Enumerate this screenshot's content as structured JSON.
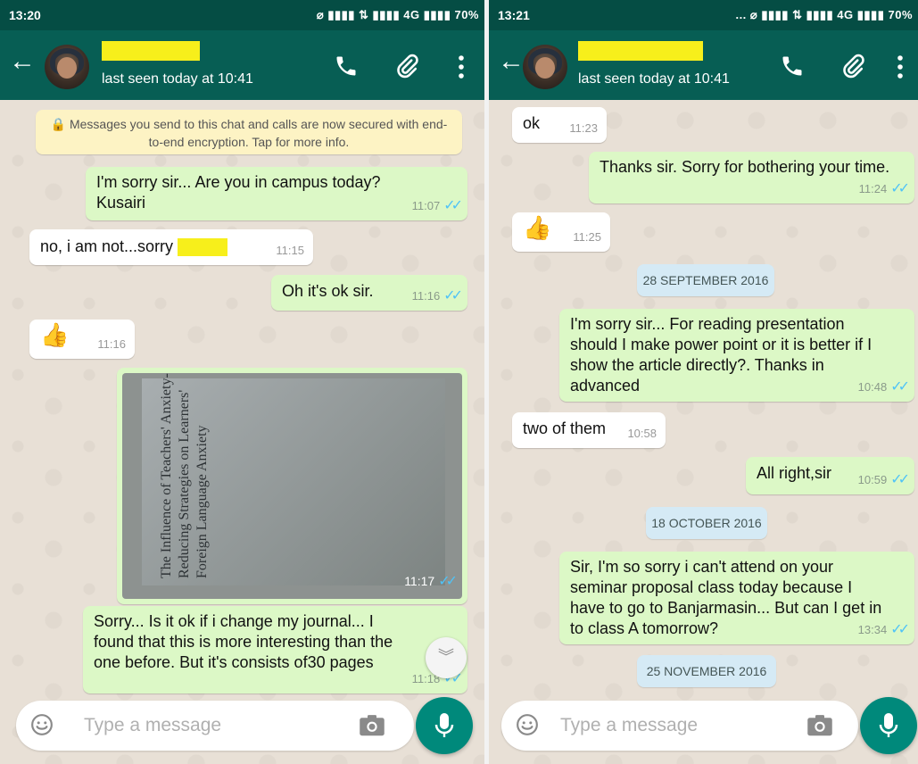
{
  "left": {
    "status": {
      "time": "13:20",
      "indicators": "⌀ ▮▮▮▮ ⇅ ▮▮▮▮ 4G  ▮▮▮▮ 70%"
    },
    "header": {
      "last_seen": "last seen today at 10:41"
    },
    "encryption_notice": "Messages you send to this chat and calls are now secured with end-to-end encryption. Tap for more info.",
    "messages": [
      {
        "text1": "I'm sorry sir... Are you in campus today?",
        "text2": "Kusairi",
        "time": "11:07"
      },
      {
        "text": "no, i am not...sorry",
        "time": "11:15"
      },
      {
        "text": "Oh it's ok sir.",
        "time": "11:16"
      },
      {
        "time": "11:16"
      },
      {
        "time": "11:17",
        "image_text": "The Influence of Teachers' Anxiety-Reducing Strategies on Learners' Foreign Language Anxiety"
      },
      {
        "line1": "Sorry... Is it ok if i change my journal... I",
        "line2": "found that this is more interesting than the",
        "line3": "one before. But it's consists of30 pages",
        "time": "11:18"
      }
    ],
    "input_placeholder": "Type a message"
  },
  "right": {
    "status": {
      "time": "13:21",
      "indicators": "... ⌀ ▮▮▮▮ ⇅ ▮▮▮▮ 4G  ▮▮▮▮ 70%"
    },
    "header": {
      "last_seen": "last seen today at 10:41"
    },
    "messages": [
      {
        "text": "ok",
        "time": "11:23"
      },
      {
        "text": "Thanks sir. Sorry for bothering your time.",
        "time": "11:24"
      },
      {
        "time": "11:25"
      },
      {
        "line1": "I'm sorry sir... For reading presentation",
        "line2": "should I make power point or it is better if I",
        "line3": "show the article directly?. Thanks in",
        "line4": "advanced",
        "time": "10:48"
      },
      {
        "text": "two of them",
        "time": "10:58"
      },
      {
        "text": "All right,sir",
        "time": "10:59"
      },
      {
        "line1": "Sir, I'm so sorry i can't attend on your",
        "line2": "seminar proposal class today because I",
        "line3": "have to go to Banjarmasin... But can I get in",
        "line4": "to class A tomorrow?",
        "time": "13:34"
      }
    ],
    "dates": [
      "28 SEPTEMBER 2016",
      "18 OCTOBER 2016",
      "25 NOVEMBER 2016"
    ],
    "input_placeholder": "Type a message"
  },
  "colors": {
    "appbar": "#075e54",
    "statusbar": "#054d44",
    "outgoing": "#dcf8c6",
    "incoming": "#ffffff",
    "read_ticks": "#4fc3f7",
    "mic_button": "#00897b"
  }
}
